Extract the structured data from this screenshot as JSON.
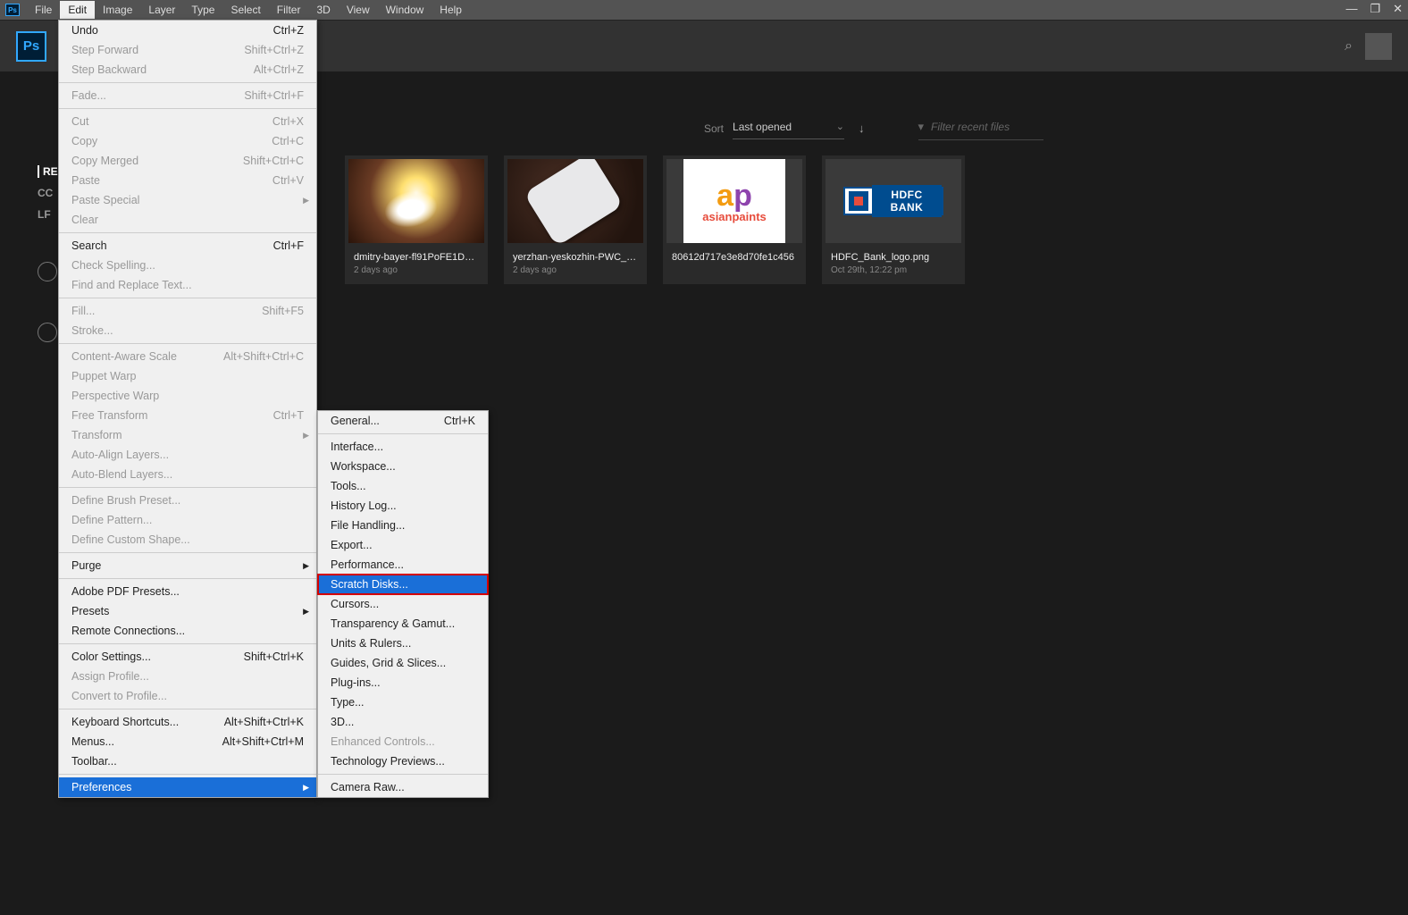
{
  "menubar": {
    "items": [
      "File",
      "Edit",
      "Image",
      "Layer",
      "Type",
      "Select",
      "Filter",
      "3D",
      "View",
      "Window",
      "Help"
    ],
    "active_index": 1
  },
  "leftnav": {
    "title": "RE",
    "items": [
      "CC",
      "LF"
    ]
  },
  "sort": {
    "label": "Sort",
    "value": "Last opened",
    "filter_placeholder": "Filter recent files"
  },
  "recent": [
    {
      "title": "dmitry-bayer-fl91PoFE1DU…",
      "meta": "2 days ago",
      "thumb": "lens"
    },
    {
      "title": "yerzhan-yeskozhin-PWC_…",
      "meta": "2 days ago",
      "thumb": "phone"
    },
    {
      "title": "80612d717e3e8d70fe1c456",
      "meta": "",
      "thumb": "ap"
    },
    {
      "title": "HDFC_Bank_logo.png",
      "meta": "Oct 29th, 12:22 pm",
      "thumb": "hdfc"
    }
  ],
  "edit_menu": [
    {
      "label": "Undo",
      "shortcut": "Ctrl+Z"
    },
    {
      "label": "Step Forward",
      "shortcut": "Shift+Ctrl+Z",
      "disabled": true
    },
    {
      "label": "Step Backward",
      "shortcut": "Alt+Ctrl+Z",
      "disabled": true
    },
    {
      "sep": true
    },
    {
      "label": "Fade...",
      "shortcut": "Shift+Ctrl+F",
      "disabled": true
    },
    {
      "sep": true
    },
    {
      "label": "Cut",
      "shortcut": "Ctrl+X",
      "disabled": true
    },
    {
      "label": "Copy",
      "shortcut": "Ctrl+C",
      "disabled": true
    },
    {
      "label": "Copy Merged",
      "shortcut": "Shift+Ctrl+C",
      "disabled": true
    },
    {
      "label": "Paste",
      "shortcut": "Ctrl+V",
      "disabled": true
    },
    {
      "label": "Paste Special",
      "submenu": true,
      "disabled": true
    },
    {
      "label": "Clear",
      "disabled": true
    },
    {
      "sep": true
    },
    {
      "label": "Search",
      "shortcut": "Ctrl+F"
    },
    {
      "label": "Check Spelling...",
      "disabled": true
    },
    {
      "label": "Find and Replace Text...",
      "disabled": true
    },
    {
      "sep": true
    },
    {
      "label": "Fill...",
      "shortcut": "Shift+F5",
      "disabled": true
    },
    {
      "label": "Stroke...",
      "disabled": true
    },
    {
      "sep": true
    },
    {
      "label": "Content-Aware Scale",
      "shortcut": "Alt+Shift+Ctrl+C",
      "disabled": true
    },
    {
      "label": "Puppet Warp",
      "disabled": true
    },
    {
      "label": "Perspective Warp",
      "disabled": true
    },
    {
      "label": "Free Transform",
      "shortcut": "Ctrl+T",
      "disabled": true
    },
    {
      "label": "Transform",
      "submenu": true,
      "disabled": true
    },
    {
      "label": "Auto-Align Layers...",
      "disabled": true
    },
    {
      "label": "Auto-Blend Layers...",
      "disabled": true
    },
    {
      "sep": true
    },
    {
      "label": "Define Brush Preset...",
      "disabled": true
    },
    {
      "label": "Define Pattern...",
      "disabled": true
    },
    {
      "label": "Define Custom Shape...",
      "disabled": true
    },
    {
      "sep": true
    },
    {
      "label": "Purge",
      "submenu": true
    },
    {
      "sep": true
    },
    {
      "label": "Adobe PDF Presets..."
    },
    {
      "label": "Presets",
      "submenu": true
    },
    {
      "label": "Remote Connections..."
    },
    {
      "sep": true
    },
    {
      "label": "Color Settings...",
      "shortcut": "Shift+Ctrl+K"
    },
    {
      "label": "Assign Profile...",
      "disabled": true
    },
    {
      "label": "Convert to Profile...",
      "disabled": true
    },
    {
      "sep": true
    },
    {
      "label": "Keyboard Shortcuts...",
      "shortcut": "Alt+Shift+Ctrl+K"
    },
    {
      "label": "Menus...",
      "shortcut": "Alt+Shift+Ctrl+M"
    },
    {
      "label": "Toolbar..."
    },
    {
      "sep": true
    },
    {
      "label": "Preferences",
      "submenu": true,
      "highlight": true
    }
  ],
  "preferences_menu": [
    {
      "label": "General...",
      "shortcut": "Ctrl+K"
    },
    {
      "sep": true
    },
    {
      "label": "Interface..."
    },
    {
      "label": "Workspace..."
    },
    {
      "label": "Tools..."
    },
    {
      "label": "History Log..."
    },
    {
      "label": "File Handling..."
    },
    {
      "label": "Export..."
    },
    {
      "label": "Performance..."
    },
    {
      "label": "Scratch Disks...",
      "highlight": true
    },
    {
      "label": "Cursors..."
    },
    {
      "label": "Transparency & Gamut..."
    },
    {
      "label": "Units & Rulers..."
    },
    {
      "label": "Guides, Grid & Slices..."
    },
    {
      "label": "Plug-ins..."
    },
    {
      "label": "Type..."
    },
    {
      "label": "3D..."
    },
    {
      "label": "Enhanced Controls...",
      "disabled": true
    },
    {
      "label": "Technology Previews..."
    },
    {
      "sep": true
    },
    {
      "label": "Camera Raw..."
    }
  ],
  "hdfc_text": "HDFC BANK",
  "ap_text": "asianpaints"
}
